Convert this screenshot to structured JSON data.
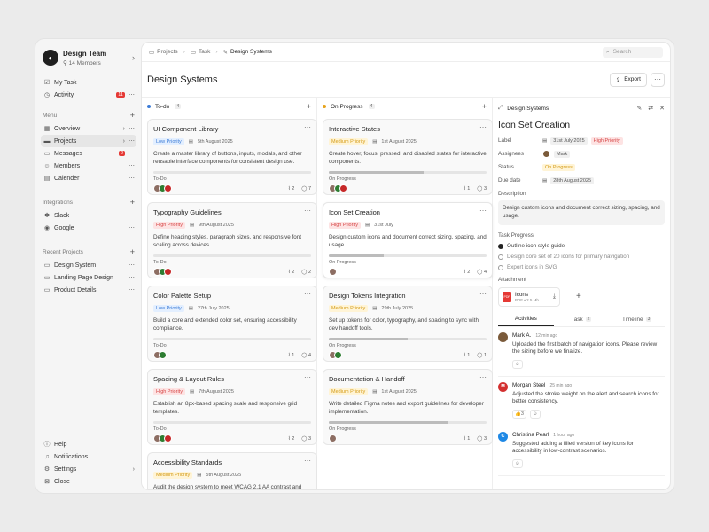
{
  "team": {
    "name": "Design Team",
    "members": "14 Members",
    "logo_icon": "team-logo-icon"
  },
  "nav_top": [
    {
      "label": "My Task",
      "icon": "check-square-icon"
    },
    {
      "label": "Activity",
      "icon": "activity-icon",
      "badge": "11"
    }
  ],
  "menu": {
    "label": "Menu",
    "items": [
      {
        "label": "Overview",
        "icon": "grid-icon"
      },
      {
        "label": "Projects",
        "icon": "folder-icon"
      },
      {
        "label": "Messages",
        "icon": "message-icon",
        "badge": "2"
      },
      {
        "label": "Members",
        "icon": "users-icon"
      },
      {
        "label": "Calender",
        "icon": "calendar-icon"
      }
    ]
  },
  "integrations": {
    "label": "Integrations",
    "items": [
      {
        "label": "Slack"
      },
      {
        "label": "Google"
      }
    ]
  },
  "recent": {
    "label": "Recent Projects",
    "items": [
      {
        "label": "Design System"
      },
      {
        "label": "Landing Page Design"
      },
      {
        "label": "Product Details"
      }
    ]
  },
  "bottom": [
    {
      "label": "Help"
    },
    {
      "label": "Notifications"
    },
    {
      "label": "Settings"
    },
    {
      "label": "Close"
    }
  ],
  "breadcrumb": [
    "Projects",
    "Task",
    "Design Systems"
  ],
  "search": {
    "placeholder": "Search"
  },
  "page": {
    "title": "Design Systems",
    "export_label": "Export"
  },
  "columns": [
    {
      "title": "To-do",
      "count": "4",
      "dot_color": "#3b7bd6",
      "cards": [
        {
          "title": "UI Component Library",
          "priority": "Low Priority",
          "priority_class": "low",
          "date": "5th August 2025",
          "desc": "Create a master library of buttons, inputs, modals, and other reusable interface components for consistent design use.",
          "progress": 0,
          "status": "To-Do",
          "attachments": "2",
          "comments": "7"
        },
        {
          "title": "Typography Guidelines",
          "priority": "High Priority",
          "priority_class": "high",
          "date": "9th August 2025",
          "desc": "Define heading styles, paragraph sizes, and responsive font scaling across devices.",
          "progress": 0,
          "status": "To-Do",
          "attachments": "2",
          "comments": "2"
        },
        {
          "title": "Color Palette Setup",
          "priority": "Low Priority",
          "priority_class": "low",
          "date": "27th July 2025",
          "desc": "Build a core and extended color set, ensuring accessibility compliance.",
          "progress": 0,
          "status": "To-Do",
          "attachments": "1",
          "comments": "4"
        },
        {
          "title": "Spacing & Layout Rules",
          "priority": "High Priority",
          "priority_class": "high",
          "date": "7th August 2025",
          "desc": "Establish an 8px-based spacing scale and responsive grid templates.",
          "progress": 0,
          "status": "To-Do",
          "attachments": "2",
          "comments": "3"
        },
        {
          "title": "Accessibility Standards",
          "priority": "Medium Priority",
          "priority_class": "medium",
          "date": "5th August 2025",
          "desc": "Audit the design system to meet WCAG 2.1 AA contrast and",
          "progress": 0,
          "status": "",
          "attachments": "",
          "comments": ""
        }
      ]
    },
    {
      "title": "On Progress",
      "count": "4",
      "dot_color": "#e7a31c",
      "cards": [
        {
          "title": "Interactive States",
          "priority": "Medium Priority",
          "priority_class": "medium",
          "date": "1st August 2025",
          "desc": "Create hover, focus, pressed, and disabled states for interactive components.",
          "progress": 0.6,
          "status": "On Progress",
          "attachments": "1",
          "comments": "3"
        },
        {
          "title": "Icon Set Creation",
          "priority": "High Priority",
          "priority_class": "high",
          "date": "31st July",
          "desc": "Design custom icons and document correct sizing, spacing, and usage.",
          "progress": 0.35,
          "status": "On Progress",
          "attachments": "2",
          "comments": "4"
        },
        {
          "title": "Design Tokens Integration",
          "priority": "Medium Priority",
          "priority_class": "medium",
          "date": "29th July 2025",
          "desc": "Set up tokens for color, typography, and spacing to sync with dev handoff tools.",
          "progress": 0.5,
          "status": "On Progress",
          "attachments": "1",
          "comments": "1"
        },
        {
          "title": "Documentation & Handoff",
          "priority": "Medium Priority",
          "priority_class": "medium",
          "date": "1st August 2025",
          "desc": "Write detailed Figma notes and export guidelines for developer implementation.",
          "progress": 0.75,
          "status": "On Progress",
          "attachments": "1",
          "comments": "3"
        }
      ]
    }
  ],
  "detail": {
    "breadcrumb": "Design Systems",
    "title": "Icon Set Creation",
    "label_key": "Label",
    "label_date": "31st July 2025",
    "label_priority": "High Priority",
    "assignees_key": "Assignees",
    "assignee": "Mark",
    "status_key": "Status",
    "status": "On Progress",
    "due_key": "Due date",
    "due": "28th August 2025",
    "description_key": "Description",
    "description": "Design custom icons and document correct sizing, spacing, and usage.",
    "progress_key": "Task Progress",
    "tasks": [
      {
        "label": "Outline icon style guide",
        "done": true
      },
      {
        "label": "Design core set of 20 icons for primary navigation",
        "done": false
      },
      {
        "label": "Export icons in SVG",
        "done": false
      }
    ],
    "attachment_key": "Attachment",
    "file": {
      "name": "Icons",
      "meta": "PDF • 2.5 Mb"
    },
    "tabs": [
      {
        "label": "Activities",
        "count": ""
      },
      {
        "label": "Task",
        "count": "2"
      },
      {
        "label": "Timeline",
        "count": "3"
      }
    ],
    "activities": [
      {
        "name": "Mark A.",
        "time": "12 min ago",
        "text": "Uploaded the first batch of navigation icons. Please review the sizing before we finalize.",
        "avatar_color": "#7a5a3a",
        "initial": "",
        "reaction": ""
      },
      {
        "name": "Morgan Steel",
        "time": "25 min ago",
        "text": "Adjusted the stroke weight on the alert and search icons for better consistency.",
        "avatar_color": "#d32f2f",
        "initial": "M",
        "reaction": "3"
      },
      {
        "name": "Christina Pearl",
        "time": "1 hour ago",
        "text": "Suggested adding a filled version of key icons for accessibility in low-contrast scenarios.",
        "avatar_color": "#1e88e5",
        "initial": "C",
        "reaction": ""
      }
    ]
  }
}
